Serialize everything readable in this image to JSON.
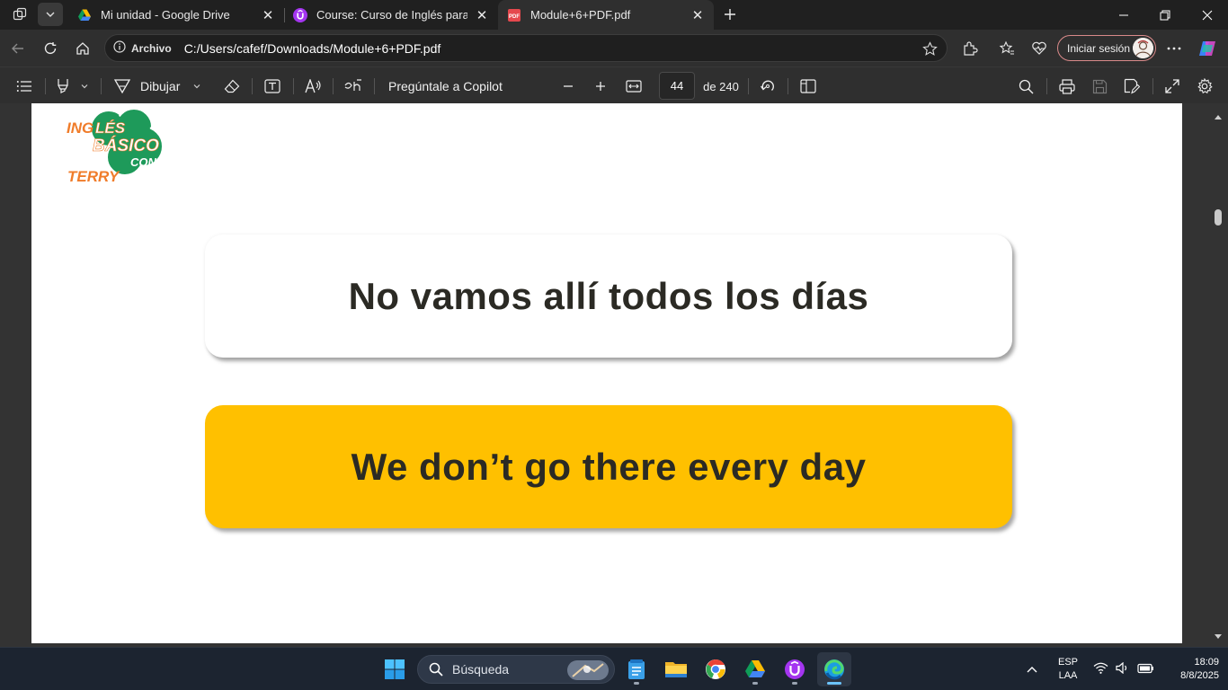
{
  "browser": {
    "tabs": [
      {
        "title": "Mi unidad - Google Drive",
        "icon": "google-drive-icon",
        "active": false
      },
      {
        "title": "Course: Curso de Inglés para principiantes",
        "icon": "udemy-icon",
        "active": false
      },
      {
        "title": "Module+6+PDF.pdf",
        "icon": "pdf-icon",
        "active": true
      }
    ],
    "address": {
      "site_label": "Archivo",
      "url": "C:/Users/cafef/Downloads/Module+6+PDF.pdf"
    },
    "signin_label": "Iniciar sesión"
  },
  "pdf_toolbar": {
    "draw_label": "Dibujar",
    "copilot_label": "Pregúntale a Copilot",
    "current_page": "44",
    "page_total": "de 240"
  },
  "document": {
    "logo": {
      "line1": "INGLÉS",
      "line2": "BÁSICO",
      "line3": "CON",
      "line4": "TERRY"
    },
    "phrase_spanish": "No vamos allí todos los días",
    "phrase_english": "We don’t go there every day",
    "colors": {
      "card_yellow": "#ffc000",
      "logo_green": "#1e9a5a",
      "logo_orange": "#f07c2a",
      "text": "#2b2a24"
    }
  },
  "taskbar": {
    "search_placeholder": "Búsqueda",
    "language_top": "ESP",
    "language_bottom": "LAA",
    "time": "18:09",
    "date": "8/8/2025",
    "apps": [
      "windows-start-icon",
      "notepad-icon",
      "file-explorer-icon",
      "google-chrome-icon",
      "google-drive-icon",
      "udemy-icon",
      "edge-icon"
    ]
  }
}
